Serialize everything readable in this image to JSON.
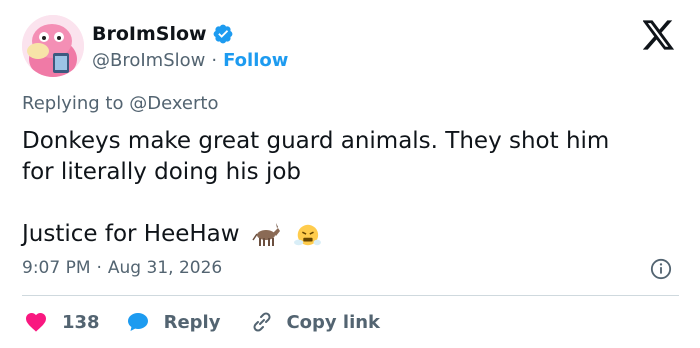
{
  "author": {
    "display_name": "BroImSlow",
    "handle": "@BroImSlow",
    "separator": "·",
    "follow_label": "Follow",
    "verified": true,
    "avatar_icon": "slowpoke-avatar"
  },
  "platform_icon": "x-logo",
  "reply_context": {
    "prefix": "Replying to ",
    "mention": "@Dexerto"
  },
  "tweet": {
    "line1": "Donkeys make great guard animals. They shot him",
    "line2": "for literally doing his job",
    "line3": "Justice for HeeHaw",
    "emojis": [
      "donkey",
      "angry-face-steam"
    ]
  },
  "meta": {
    "time": "9:07 PM",
    "separator": "·",
    "date": "Aug 31, 2026"
  },
  "actions": {
    "like_count": "138",
    "reply_label": "Reply",
    "copy_label": "Copy link"
  },
  "colors": {
    "accent": "#1d9bf0",
    "like": "#f91880",
    "text": "#0f1419",
    "muted": "#536471"
  }
}
